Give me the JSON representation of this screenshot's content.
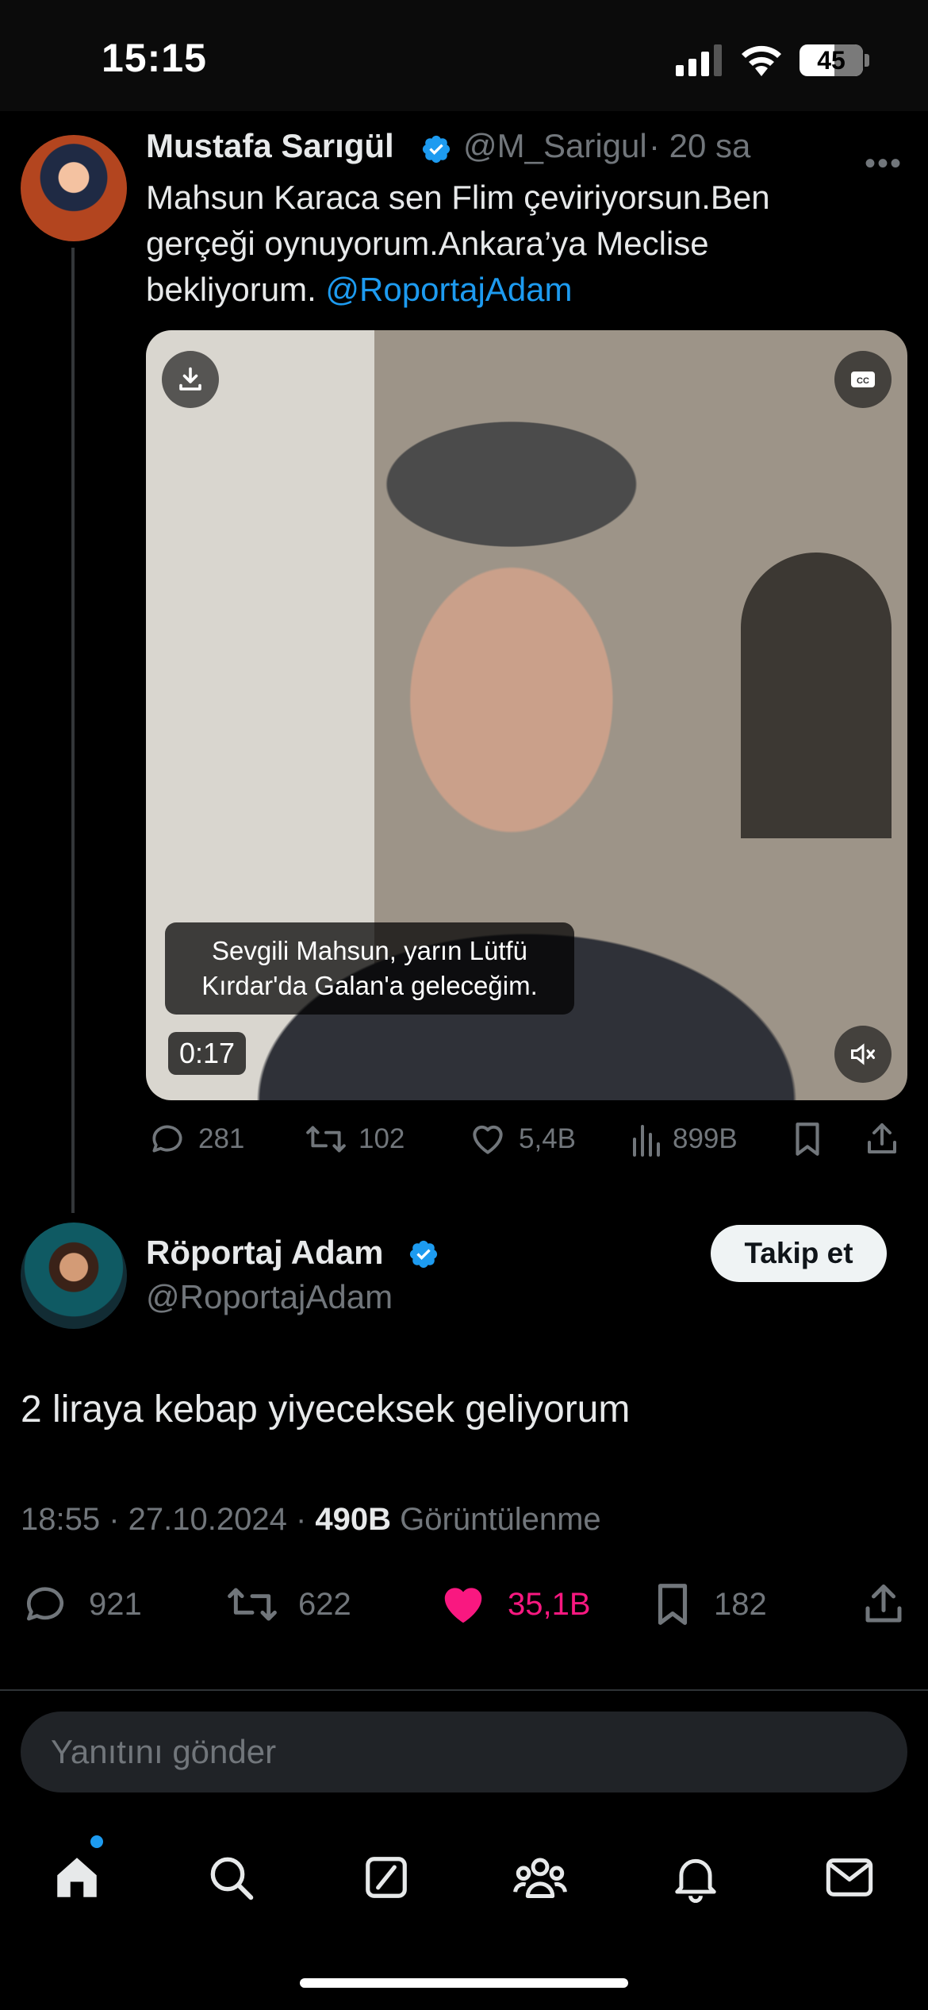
{
  "status_bar": {
    "time": "15:15",
    "battery": "45"
  },
  "parent_tweet": {
    "name": "Mustafa Sarıgül",
    "handle": "@M_Sarigul",
    "time_ago": "· 20 sa",
    "text": "Mahsun Karaca sen Flim çeviriyorsun.Ben gerçeği oynuyorum.Ankara’ya Meclise bekliyorum.",
    "mention": "@RoportajAdam",
    "video": {
      "caption_line1": "Sevgili Mahsun, yarın Lütfü",
      "caption_line2": "Kırdar'da Galan'a geleceğim.",
      "duration": "0:17"
    },
    "stats": {
      "replies": "281",
      "retweets": "102",
      "likes": "5,4B",
      "views": "899B"
    }
  },
  "main_tweet": {
    "name": "Röportaj Adam",
    "handle": "@RoportajAdam",
    "follow_label": "Takip et",
    "text": "2 liraya kebap yiyeceksek geliyorum",
    "timestamp": "18:55 · 27.10.2024 ·",
    "views_count": "490B",
    "views_label": "Görüntülenme",
    "stats": {
      "replies": "921",
      "retweets": "622",
      "likes": "35,1B",
      "bookmarks": "182"
    }
  },
  "reply": {
    "placeholder": "Yanıtını gönder"
  },
  "colors": {
    "accent": "#1d9bf0",
    "like": "#f91880",
    "muted": "#71767b"
  },
  "icons": [
    "home-icon",
    "search-icon",
    "compose-icon",
    "communities-icon",
    "notifications-icon",
    "messages-icon"
  ]
}
